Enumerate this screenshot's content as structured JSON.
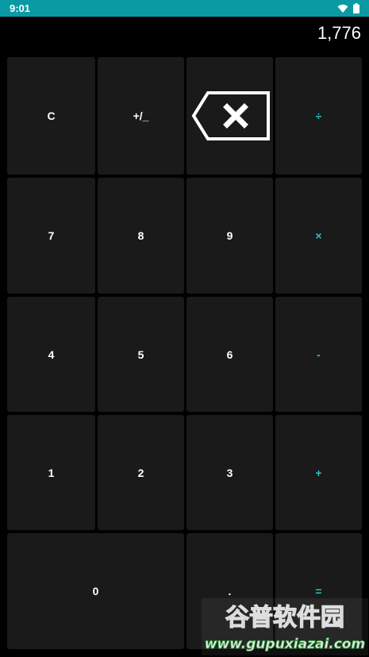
{
  "status_bar": {
    "time": "9:01",
    "icons": [
      "wifi-icon",
      "battery-icon"
    ]
  },
  "display": {
    "value": "1,776"
  },
  "keys": {
    "clear": "C",
    "sign": "+/_",
    "backspace_icon": "backspace-icon",
    "divide": "÷",
    "seven": "7",
    "eight": "8",
    "nine": "9",
    "multiply": "×",
    "four": "4",
    "five": "5",
    "six": "6",
    "minus": "-",
    "one": "1",
    "two": "2",
    "three": "3",
    "plus": "+",
    "zero": "0",
    "dot": ".",
    "equals": "="
  },
  "watermark": {
    "name": "谷普软件园",
    "url": "www.gupuxiazai.com"
  },
  "colors": {
    "status_bar": "#0a9aa3",
    "background": "#000000",
    "key": "#1a1a1a",
    "text": "#ffffff",
    "operator": "#25c3c9"
  }
}
